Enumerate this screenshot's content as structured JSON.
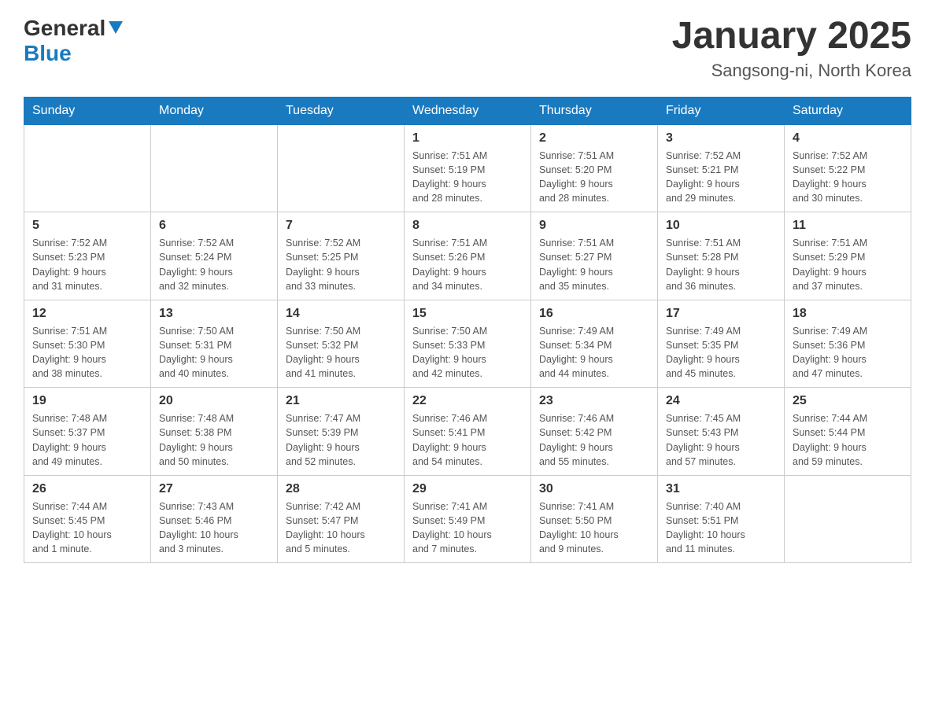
{
  "header": {
    "logo_general": "General",
    "logo_blue": "Blue",
    "month_title": "January 2025",
    "location": "Sangsong-ni, North Korea"
  },
  "weekdays": [
    "Sunday",
    "Monday",
    "Tuesday",
    "Wednesday",
    "Thursday",
    "Friday",
    "Saturday"
  ],
  "weeks": [
    [
      {
        "day": "",
        "info": ""
      },
      {
        "day": "",
        "info": ""
      },
      {
        "day": "",
        "info": ""
      },
      {
        "day": "1",
        "info": "Sunrise: 7:51 AM\nSunset: 5:19 PM\nDaylight: 9 hours\nand 28 minutes."
      },
      {
        "day": "2",
        "info": "Sunrise: 7:51 AM\nSunset: 5:20 PM\nDaylight: 9 hours\nand 28 minutes."
      },
      {
        "day": "3",
        "info": "Sunrise: 7:52 AM\nSunset: 5:21 PM\nDaylight: 9 hours\nand 29 minutes."
      },
      {
        "day": "4",
        "info": "Sunrise: 7:52 AM\nSunset: 5:22 PM\nDaylight: 9 hours\nand 30 minutes."
      }
    ],
    [
      {
        "day": "5",
        "info": "Sunrise: 7:52 AM\nSunset: 5:23 PM\nDaylight: 9 hours\nand 31 minutes."
      },
      {
        "day": "6",
        "info": "Sunrise: 7:52 AM\nSunset: 5:24 PM\nDaylight: 9 hours\nand 32 minutes."
      },
      {
        "day": "7",
        "info": "Sunrise: 7:52 AM\nSunset: 5:25 PM\nDaylight: 9 hours\nand 33 minutes."
      },
      {
        "day": "8",
        "info": "Sunrise: 7:51 AM\nSunset: 5:26 PM\nDaylight: 9 hours\nand 34 minutes."
      },
      {
        "day": "9",
        "info": "Sunrise: 7:51 AM\nSunset: 5:27 PM\nDaylight: 9 hours\nand 35 minutes."
      },
      {
        "day": "10",
        "info": "Sunrise: 7:51 AM\nSunset: 5:28 PM\nDaylight: 9 hours\nand 36 minutes."
      },
      {
        "day": "11",
        "info": "Sunrise: 7:51 AM\nSunset: 5:29 PM\nDaylight: 9 hours\nand 37 minutes."
      }
    ],
    [
      {
        "day": "12",
        "info": "Sunrise: 7:51 AM\nSunset: 5:30 PM\nDaylight: 9 hours\nand 38 minutes."
      },
      {
        "day": "13",
        "info": "Sunrise: 7:50 AM\nSunset: 5:31 PM\nDaylight: 9 hours\nand 40 minutes."
      },
      {
        "day": "14",
        "info": "Sunrise: 7:50 AM\nSunset: 5:32 PM\nDaylight: 9 hours\nand 41 minutes."
      },
      {
        "day": "15",
        "info": "Sunrise: 7:50 AM\nSunset: 5:33 PM\nDaylight: 9 hours\nand 42 minutes."
      },
      {
        "day": "16",
        "info": "Sunrise: 7:49 AM\nSunset: 5:34 PM\nDaylight: 9 hours\nand 44 minutes."
      },
      {
        "day": "17",
        "info": "Sunrise: 7:49 AM\nSunset: 5:35 PM\nDaylight: 9 hours\nand 45 minutes."
      },
      {
        "day": "18",
        "info": "Sunrise: 7:49 AM\nSunset: 5:36 PM\nDaylight: 9 hours\nand 47 minutes."
      }
    ],
    [
      {
        "day": "19",
        "info": "Sunrise: 7:48 AM\nSunset: 5:37 PM\nDaylight: 9 hours\nand 49 minutes."
      },
      {
        "day": "20",
        "info": "Sunrise: 7:48 AM\nSunset: 5:38 PM\nDaylight: 9 hours\nand 50 minutes."
      },
      {
        "day": "21",
        "info": "Sunrise: 7:47 AM\nSunset: 5:39 PM\nDaylight: 9 hours\nand 52 minutes."
      },
      {
        "day": "22",
        "info": "Sunrise: 7:46 AM\nSunset: 5:41 PM\nDaylight: 9 hours\nand 54 minutes."
      },
      {
        "day": "23",
        "info": "Sunrise: 7:46 AM\nSunset: 5:42 PM\nDaylight: 9 hours\nand 55 minutes."
      },
      {
        "day": "24",
        "info": "Sunrise: 7:45 AM\nSunset: 5:43 PM\nDaylight: 9 hours\nand 57 minutes."
      },
      {
        "day": "25",
        "info": "Sunrise: 7:44 AM\nSunset: 5:44 PM\nDaylight: 9 hours\nand 59 minutes."
      }
    ],
    [
      {
        "day": "26",
        "info": "Sunrise: 7:44 AM\nSunset: 5:45 PM\nDaylight: 10 hours\nand 1 minute."
      },
      {
        "day": "27",
        "info": "Sunrise: 7:43 AM\nSunset: 5:46 PM\nDaylight: 10 hours\nand 3 minutes."
      },
      {
        "day": "28",
        "info": "Sunrise: 7:42 AM\nSunset: 5:47 PM\nDaylight: 10 hours\nand 5 minutes."
      },
      {
        "day": "29",
        "info": "Sunrise: 7:41 AM\nSunset: 5:49 PM\nDaylight: 10 hours\nand 7 minutes."
      },
      {
        "day": "30",
        "info": "Sunrise: 7:41 AM\nSunset: 5:50 PM\nDaylight: 10 hours\nand 9 minutes."
      },
      {
        "day": "31",
        "info": "Sunrise: 7:40 AM\nSunset: 5:51 PM\nDaylight: 10 hours\nand 11 minutes."
      },
      {
        "day": "",
        "info": ""
      }
    ]
  ]
}
